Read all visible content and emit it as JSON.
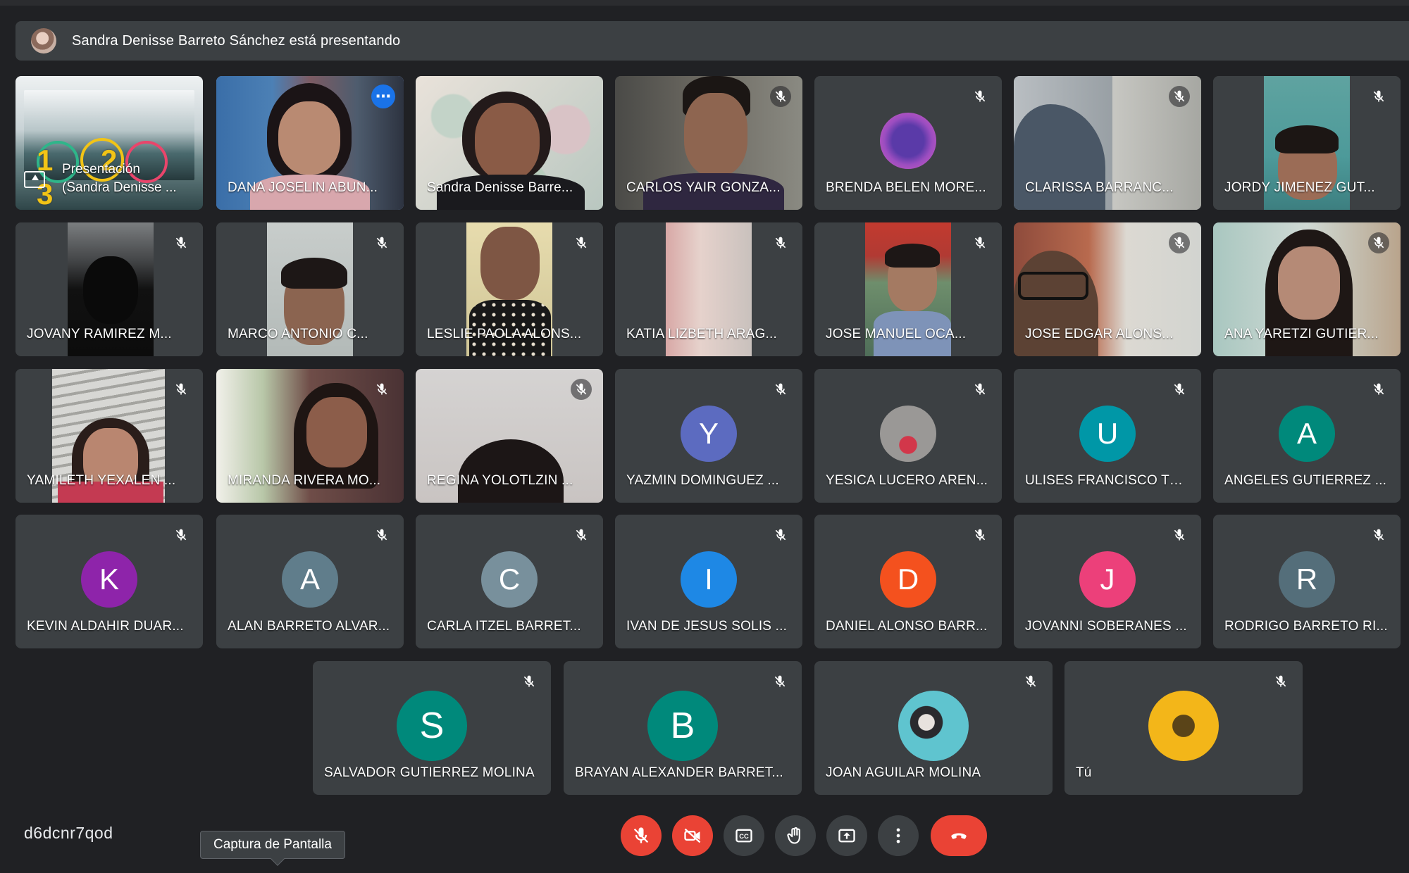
{
  "presenting": {
    "text": "Sandra Denisse Barreto Sánchez está presentando"
  },
  "presentation_tile": {
    "slide_text": "1 2 3",
    "label_line1": "Presentación",
    "label_line2": "(Sandra Denisse ..."
  },
  "participants": [
    {
      "name": "DANA JOSELIN ABUN...",
      "type": "video",
      "active": true
    },
    {
      "name": "Sandra Denisse Barre...",
      "type": "video"
    },
    {
      "name": "CARLOS YAIR GONZA...",
      "type": "video",
      "muted": true
    },
    {
      "name": "BRENDA BELEN MORE...",
      "type": "photo",
      "muted": true
    },
    {
      "name": "CLARISSA BARRANC...",
      "type": "video",
      "muted": true
    },
    {
      "name": "JORDY JIMENEZ GUT...",
      "type": "video",
      "muted": true
    },
    {
      "name": "JOVANY RAMIREZ M...",
      "type": "video",
      "muted": true
    },
    {
      "name": "MARCO ANTONIO C...",
      "type": "video",
      "muted": true
    },
    {
      "name": "LESLIE PAOLA ALONS...",
      "type": "video",
      "muted": true
    },
    {
      "name": "KATIA LIZBETH ARAG...",
      "type": "video",
      "muted": true
    },
    {
      "name": "JOSE MANUEL OCA...",
      "type": "video",
      "muted": true
    },
    {
      "name": "JOSE EDGAR ALONS...",
      "type": "video",
      "muted": true
    },
    {
      "name": "ANA YARETZI GUTIER...",
      "type": "video",
      "muted": true
    },
    {
      "name": "YAMILETH YEXALEN ...",
      "type": "video",
      "muted": true
    },
    {
      "name": "MIRANDA RIVERA MO...",
      "type": "video",
      "muted": true
    },
    {
      "name": "REGINA YOLOTLZIN ...",
      "type": "video",
      "muted": true
    },
    {
      "name": "YAZMIN DOMINGUEZ ...",
      "type": "initial",
      "initial": "Y",
      "color": "#5c6bc0",
      "muted": true
    },
    {
      "name": "YESICA LUCERO AREN...",
      "type": "photo",
      "muted": true
    },
    {
      "name": "ULISES FRANCISCO TU...",
      "type": "initial",
      "initial": "U",
      "color": "#0097a7",
      "muted": true
    },
    {
      "name": "ANGELES GUTIERREZ ...",
      "type": "initial",
      "initial": "A",
      "color": "#00897b",
      "muted": true
    },
    {
      "name": "KEVIN ALDAHIR DUAR...",
      "type": "initial",
      "initial": "K",
      "color": "#8e24aa",
      "muted": true
    },
    {
      "name": "ALAN BARRETO ALVAR...",
      "type": "initial",
      "initial": "A",
      "color": "#607d8b",
      "muted": true
    },
    {
      "name": "CARLA ITZEL BARRET...",
      "type": "initial",
      "initial": "C",
      "color": "#78909c",
      "muted": true
    },
    {
      "name": "IVAN DE JESUS SOLIS ...",
      "type": "initial",
      "initial": "I",
      "color": "#1e88e5",
      "muted": true
    },
    {
      "name": "DANIEL ALONSO BARR...",
      "type": "initial",
      "initial": "D",
      "color": "#f4511e",
      "muted": true
    },
    {
      "name": "JOVANNI SOBERANES ...",
      "type": "initial",
      "initial": "J",
      "color": "#ec407a",
      "muted": true
    },
    {
      "name": "RODRIGO BARRETO RI...",
      "type": "initial",
      "initial": "R",
      "color": "#546e7a",
      "muted": true
    },
    {
      "name": "SALVADOR GUTIERREZ MOLINA",
      "type": "initial",
      "initial": "S",
      "color": "#00897b",
      "muted": true
    },
    {
      "name": "BRAYAN ALEXANDER BARRET...",
      "type": "initial",
      "initial": "B",
      "color": "#00897b",
      "muted": true
    },
    {
      "name": "JOAN AGUILAR MOLINA",
      "type": "photo",
      "muted": true
    },
    {
      "name": "Tú",
      "type": "photo",
      "muted": true
    }
  ],
  "meeting_code": "d6dcnr7qod",
  "tooltip": "Captura de Pantalla",
  "colors": {
    "accent": "#8ab4f8",
    "danger": "#ea4335",
    "tile": "#3c4043",
    "background": "#202124"
  },
  "controls": [
    "mic-off-icon",
    "camera-off-icon",
    "captions-icon",
    "raise-hand-icon",
    "present-icon",
    "more-vert-icon",
    "end-call-icon"
  ]
}
